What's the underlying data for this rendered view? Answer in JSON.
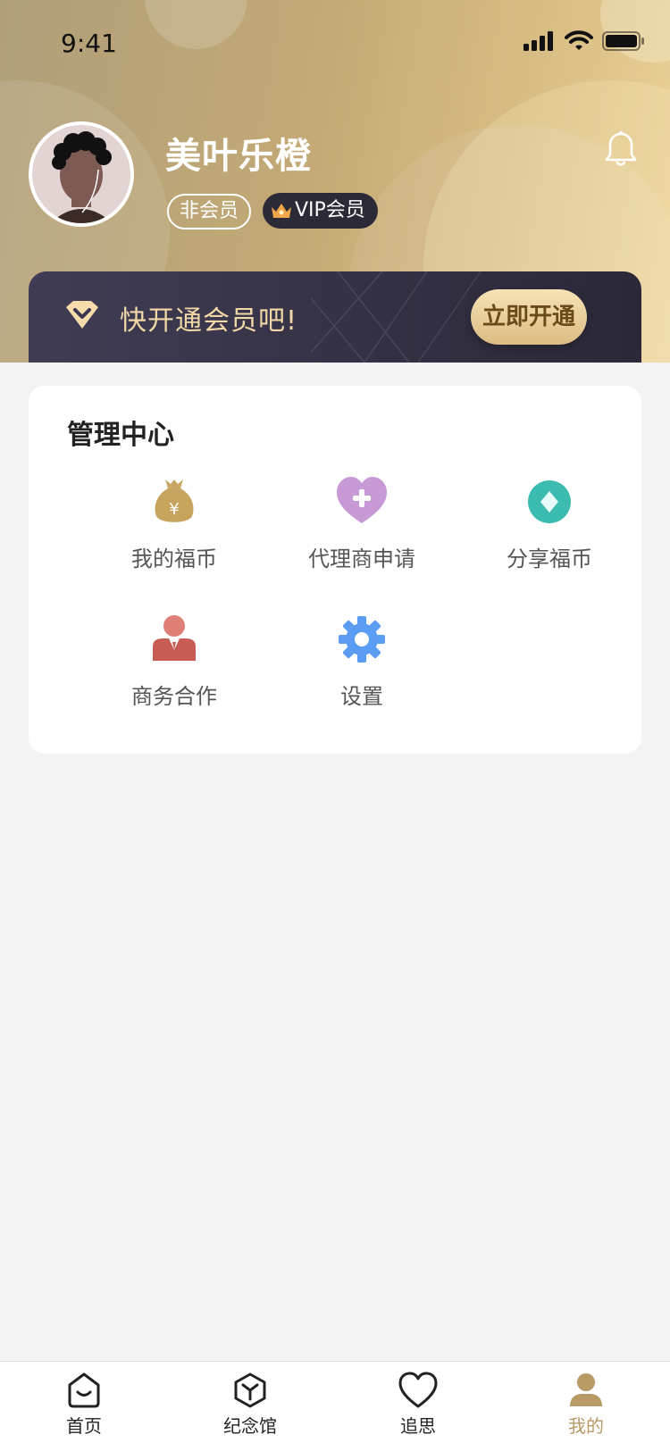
{
  "status_bar": {
    "time": "9:41"
  },
  "profile": {
    "name": "美叶乐橙",
    "tags": {
      "non_member": "非会员",
      "vip": "VIP会员"
    }
  },
  "vip_banner": {
    "text": "快开通会员吧!",
    "button": "立即开通"
  },
  "management": {
    "title": "管理中心",
    "items": [
      {
        "label": "我的福币",
        "icon": "money-bag-icon"
      },
      {
        "label": "代理商申请",
        "icon": "heart-plus-icon"
      },
      {
        "label": "分享福币",
        "icon": "diamond-coin-icon"
      },
      {
        "label": "商务合作",
        "icon": "business-person-icon"
      },
      {
        "label": "设置",
        "icon": "gear-icon"
      }
    ]
  },
  "tabbar": {
    "items": [
      {
        "label": "首页",
        "icon": "home-icon"
      },
      {
        "label": "纪念馆",
        "icon": "cube-icon"
      },
      {
        "label": "追思",
        "icon": "heart-icon"
      },
      {
        "label": "我的",
        "icon": "user-icon"
      }
    ],
    "active": "我的"
  },
  "colors": {
    "header_gold": "#c3a975",
    "banner_dark": "#2b2838",
    "accent_gold": "#b89a67",
    "page_bg": "#f3f3f3"
  }
}
